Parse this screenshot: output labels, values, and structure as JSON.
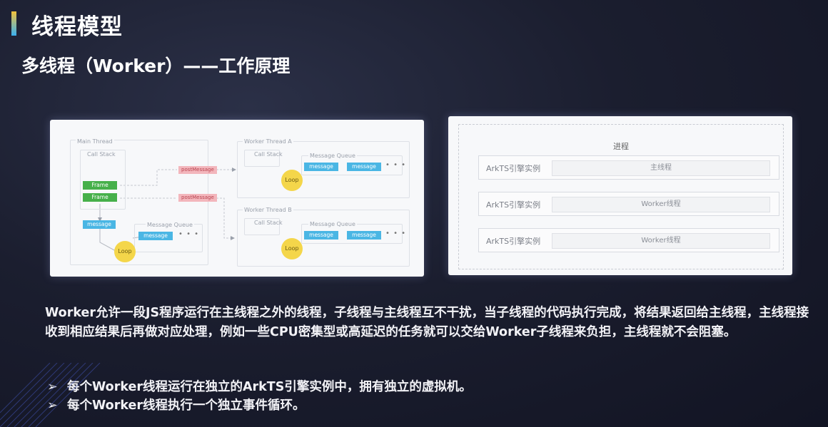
{
  "slide": {
    "title": "线程模型",
    "subtitle": "多线程（Worker）——工作原理"
  },
  "left_diagram": {
    "main_thread": "Main Thread",
    "call_stack": "Call Stack",
    "frame": "Frame",
    "message": "message",
    "message_queue": "Message Queue",
    "loop": "Loop",
    "post_message": "postMessage",
    "worker_a": "Worker Thread A",
    "worker_b": "Worker Thread B",
    "dots": "• • •"
  },
  "right_diagram": {
    "process_title": "进程",
    "rows": [
      {
        "engine": "ArkTS引擎实例",
        "thread": "主线程"
      },
      {
        "engine": "ArkTS引擎实例",
        "thread": "Worker线程"
      },
      {
        "engine": "ArkTS引擎实例",
        "thread": "Worker线程"
      }
    ]
  },
  "description": "Worker允许一段JS程序运行在主线程之外的线程，子线程与主线程互不干扰，当子线程的代码执行完成，将结果返回给主线程，主线程接收到相应结果后再做对应处理，例如一些CPU密集型或高延迟的任务就可以交给Worker子线程来负担，主线程就不会阻塞。",
  "bullets": [
    {
      "arrow": "➢",
      "text": "每个Worker线程运行在独立的ArkTS引擎实例中，拥有独立的虚拟机。"
    },
    {
      "arrow": "➢",
      "text": "每个Worker线程执行一个独立事件循环。"
    }
  ],
  "colors": {
    "accent_top": "#f4c23a",
    "accent_bottom": "#3ab0f0",
    "frame_green": "#46b04a",
    "message_blue": "#4ab6e4",
    "post_pink": "#f3b6bc",
    "loop_yellow": "#f4d64a"
  }
}
